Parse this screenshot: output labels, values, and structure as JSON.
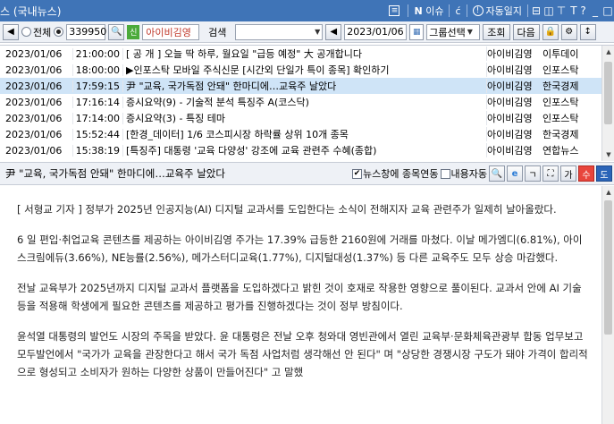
{
  "window": {
    "title": "스 (국내뉴스)",
    "issue_label": "이슈",
    "auto_log_label": "자동일지",
    "help_label": "T ?"
  },
  "toolbar": {
    "radio_all_label": "전체",
    "stock_code": "339950",
    "market_badge": "신",
    "stock_name": "아이비김영",
    "search_button": "검색",
    "search_value": "",
    "date": "2023/01/06",
    "group_select": "그룹선택",
    "query_button": "조회",
    "next_button": "다음"
  },
  "news_list": {
    "rows": [
      {
        "date": "2023/01/06",
        "time": "21:00:00",
        "title": "[ 공 개 ] 오늘 딱 하루, 월요일 \"급등 예정\" 大 공개합니다",
        "stock": "아이비김영",
        "source": "이투데이"
      },
      {
        "date": "2023/01/06",
        "time": "18:00:00",
        "title": "▶인포스탁 모바일 주식신문 [시간외 단일가 특이 종목] 확인하기",
        "stock": "아이비김영",
        "source": "인포스탁"
      },
      {
        "date": "2023/01/06",
        "time": "17:59:15",
        "title": "尹 \"교육, 국가독점 안돼\" 한마디에…교육주 날았다",
        "stock": "아이비김영",
        "source": "한국경제",
        "selected": true
      },
      {
        "date": "2023/01/06",
        "time": "17:16:14",
        "title": "증시요약(9) - 기술적 분석 특징주 A(코스닥)",
        "stock": "아이비김영",
        "source": "인포스탁"
      },
      {
        "date": "2023/01/06",
        "time": "17:14:00",
        "title": "증시요약(3) - 특징 테마",
        "stock": "아이비김영",
        "source": "인포스탁"
      },
      {
        "date": "2023/01/06",
        "time": "15:52:44",
        "title": "[한경_데이터] 1/6 코스피시장 하락률 상위 10개 종목",
        "stock": "아이비김영",
        "source": "한국경제"
      },
      {
        "date": "2023/01/06",
        "time": "15:38:19",
        "title": "[특징주] 대통령 '교육 다양성' 강조에 교육 관련주 수혜(종합)",
        "stock": "아이비김영",
        "source": "연합뉴스"
      }
    ]
  },
  "article": {
    "title": "尹 \"교육, 국가독점 안돼\" 한마디에…교육주 날았다",
    "link_label": "뉴스창에 종목연동",
    "auto_label": "내용자동",
    "paragraphs": [
      "[ 서형교 기자 ] 정부가 2025년 인공지능(AI) 디지털 교과서를 도입한다는 소식이 전해지자 교육 관련주가 일제히 날아올랐다.",
      "6 일 편입·취업교육 콘텐츠를 제공하는 아이비김영 주가는 17.39% 급등한 2160원에 거래를 마쳤다. 이날 메가엠디(6.81%), 아이스크림에듀(3.66%), NE능률(2.56%), 메가스터디교육(1.77%), 디지털대성(1.37%) 등 다른 교육주도 모두 상승 마감했다.",
      "전날 교육부가 2025년까지 디지털 교과서 플랫폼을 도입하겠다고 밝힌 것이 호재로 작용한 영향으로 풀이된다. 교과서 안에 AI 기술 등을 적용해 학생에게 필요한 콘텐츠를 제공하고 평가를 진행하겠다는 것이 정부 방침이다.",
      "윤석열 대통령의 발언도 시장의 주목을 받았다. 윤 대통령은 전날 오후 청와대 영빈관에서 열린 교육부·문화체육관광부 합동 업무보고 모두발언에서 \"국가가 교육을 관장한다고 해서 국가 독점 사업처럼 생각해선 안 된다\" 며 \"상당한 경쟁시장 구도가 돼야 가격이 합리적으로 형성되고 소비자가 원하는 다양한 상품이 만들어진다\" 고 말했"
    ]
  },
  "colors": {
    "titlebar": "#3f74b7",
    "selected_row": "#cfe4f7",
    "red_button": "#e8453c",
    "blue_button": "#2b64b8"
  }
}
